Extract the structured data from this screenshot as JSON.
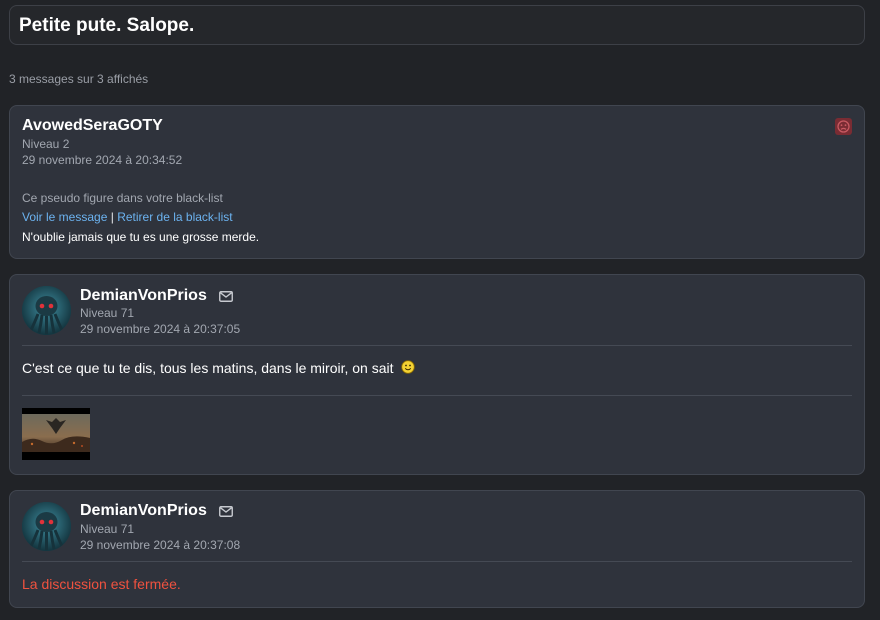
{
  "topic": {
    "title": "Petite pute. Salope."
  },
  "pagination": {
    "count_text": "3 messages sur 3 affichés"
  },
  "messages": [
    {
      "author": "AvowedSeraGOTY",
      "level": "Niveau 2",
      "date": "29 novembre 2024 à 20:34:52",
      "blacklist_note": "Ce pseudo figure dans votre black-list",
      "view_link": "Voir le message",
      "separator": "|",
      "remove_link": "Retirer de la black-list",
      "body": "N'oublie jamais que tu es une grosse merde.",
      "icon": "blocked-face-icon"
    },
    {
      "author": "DemianVonPrios",
      "level": "Niveau 71",
      "date": "29 novembre 2024 à 20:37:05",
      "body": "C'est ce que tu te dis, tous les matins, dans le miroir, on sait",
      "icon": "mail-icon"
    },
    {
      "author": "DemianVonPrios",
      "level": "Niveau 71",
      "date": "29 novembre 2024 à 20:37:08",
      "closed_text": "La discussion est fermée.",
      "icon": "mail-icon"
    }
  ],
  "colors": {
    "background": "#212327",
    "card": "#2f333c",
    "link": "#6cb3f0",
    "closed": "#f0523f",
    "blocked_icon": "#7a2c33"
  }
}
